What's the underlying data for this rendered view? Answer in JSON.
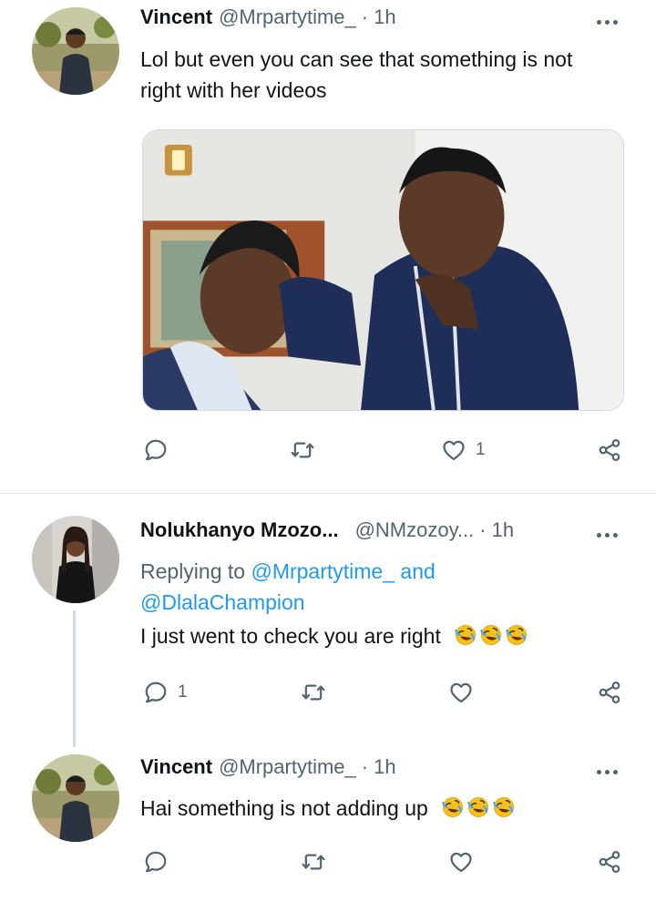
{
  "tweets": [
    {
      "name": "Vincent",
      "handle": "@Mrpartytime_",
      "dot": "·",
      "time": "1h",
      "text_line1": "Lol but even you can see that something is not",
      "text_line2": "right with her videos",
      "reply_count": "",
      "like_count": "1"
    },
    {
      "name": "Nolukhanyo Mzozo...",
      "handle": "@NMzozoy...",
      "dot": "·",
      "time": "1h",
      "replying_prefix": "Replying to",
      "replying_mention1": "@Mrpartytime_ and",
      "replying_mention2": "@DlalaChampion",
      "text": "I just went to check you are right",
      "emoji": "rolling-on-floor-laughing x3",
      "reply_count": "1",
      "like_count": ""
    },
    {
      "name": "Vincent",
      "handle": "@Mrpartytime_",
      "dot": "·",
      "time": "1h",
      "text": "Hai something is not adding up",
      "emoji": "rolling-on-floor-laughing x3",
      "reply_count": "",
      "like_count": ""
    }
  ],
  "icons": [
    "reply-icon",
    "retweet-icon",
    "like-icon",
    "share-icon",
    "more-icon"
  ],
  "colors": {
    "text": "#0f1419",
    "secondary": "#536471",
    "link": "#1d9bf0",
    "divider": "#e4e8ea"
  }
}
